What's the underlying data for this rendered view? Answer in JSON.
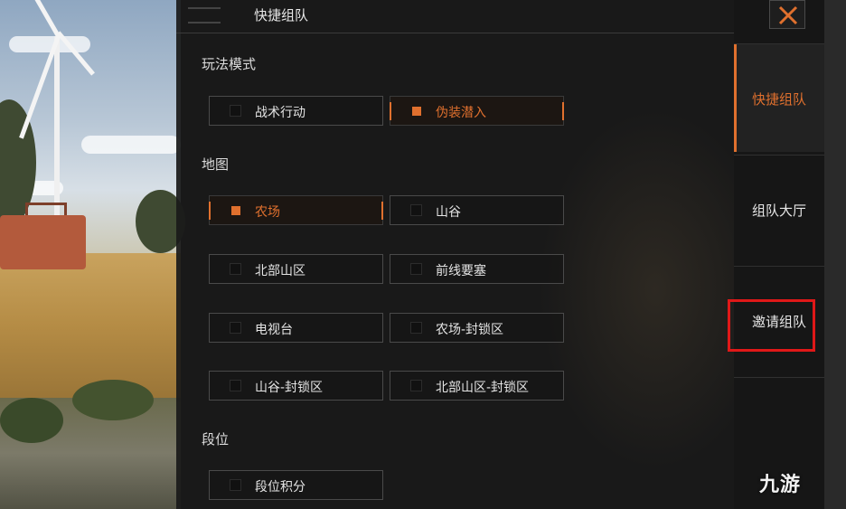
{
  "panel": {
    "title": "快捷组队"
  },
  "sections": {
    "mode": {
      "title": "玩法模式",
      "options": [
        {
          "label": "战术行动",
          "selected": false
        },
        {
          "label": "伪装潜入",
          "selected": true
        }
      ]
    },
    "map": {
      "title": "地图",
      "options": [
        {
          "label": "农场",
          "selected": true
        },
        {
          "label": "山谷",
          "selected": false
        },
        {
          "label": "北部山区",
          "selected": false
        },
        {
          "label": "前线要塞",
          "selected": false
        },
        {
          "label": "电视台",
          "selected": false
        },
        {
          "label": "农场-封锁区",
          "selected": false
        },
        {
          "label": "山谷-封锁区",
          "selected": false
        },
        {
          "label": "北部山区-封锁区",
          "selected": false
        }
      ]
    },
    "rank": {
      "title": "段位",
      "options": [
        {
          "label": "段位积分",
          "selected": false
        }
      ]
    }
  },
  "tabs": [
    {
      "label": "快捷组队",
      "active": true
    },
    {
      "label": "组队大厅",
      "active": false
    },
    {
      "label": "邀请组队",
      "active": false,
      "highlighted": true
    }
  ],
  "watermark": "九游",
  "colors": {
    "accent": "#e0702e",
    "highlight": "#e01818",
    "panel": "#1a1a1a"
  },
  "icons": {
    "close": "close-icon",
    "checkbox": "checkbox-icon"
  }
}
